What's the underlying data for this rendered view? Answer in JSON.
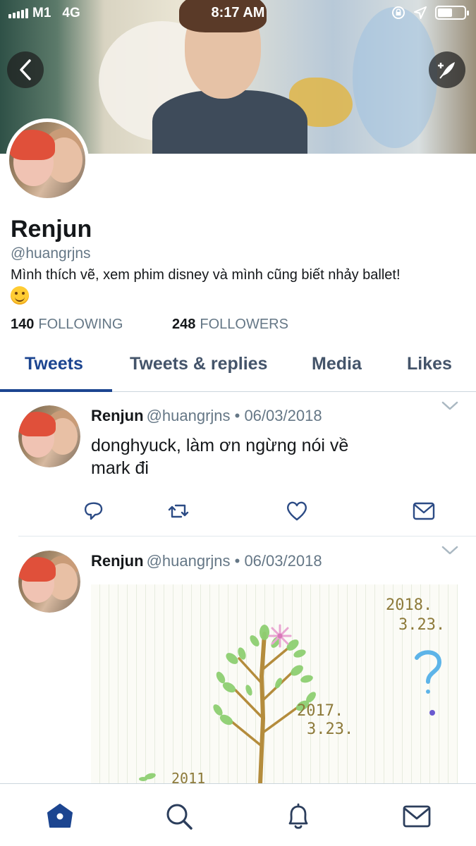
{
  "status_bar": {
    "carrier": "M1",
    "network": "4G",
    "time": "8:17 AM"
  },
  "header": {
    "back_icon": "chevron-left-icon",
    "compose_icon": "feather-compose-icon"
  },
  "profile": {
    "name": "Renjun",
    "handle": "@huangrjns",
    "bio": "Mình thích vẽ, xem phim disney và mình cũng biết nhảy ballet!",
    "bio_emoji": "smiling-face-emoji",
    "following_count": "140",
    "following_label": "FOLLOWING",
    "followers_count": "248",
    "followers_label": "FOLLOWERS"
  },
  "tabs": [
    {
      "label": "Tweets",
      "active": true
    },
    {
      "label": "Tweets & replies",
      "active": false
    },
    {
      "label": "Media",
      "active": false
    },
    {
      "label": "Likes",
      "active": false
    }
  ],
  "tweets": [
    {
      "name": "Renjun",
      "meta": "@huangrjns • 06/03/2018",
      "text_line1": "donghyuck, làm ơn ngừng nói về",
      "text_line2": "mark đi"
    },
    {
      "name": "Renjun",
      "meta": "@huangrjns • 06/03/2018",
      "media_text_1": "2018.",
      "media_text_2": "3.23.",
      "media_text_3": "2017.",
      "media_text_4": "3.23.",
      "media_text_5": "2011",
      "media_text_6": "?"
    }
  ],
  "colors": {
    "accent": "#1c4590",
    "muted": "#657786",
    "divider": "#e1e8ed"
  },
  "bottom_nav": [
    "home-icon",
    "search-icon",
    "notifications-icon",
    "messages-icon"
  ]
}
